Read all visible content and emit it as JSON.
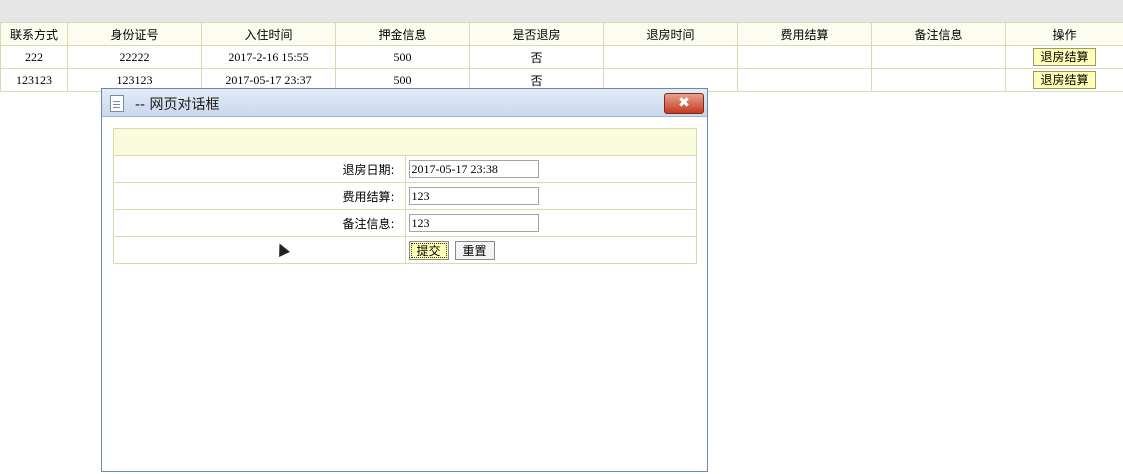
{
  "table": {
    "headers": [
      "联系方式",
      "身份证号",
      "入住时间",
      "押金信息",
      "是否退房",
      "退房时间",
      "费用结算",
      "备注信息",
      "操作"
    ],
    "rows": [
      {
        "contact": "222",
        "id_number": "22222",
        "checkin_time": "2017-2-16 15:55",
        "deposit": "500",
        "checked_out": "否",
        "checkout_time": "",
        "settlement": "",
        "remark": "",
        "action": "退房结算"
      },
      {
        "contact": "123123",
        "id_number": "123123",
        "checkin_time": "2017-05-17 23:37",
        "deposit": "500",
        "checked_out": "否",
        "checkout_time": "",
        "settlement": "",
        "remark": "",
        "action": "退房结算"
      }
    ]
  },
  "dialog": {
    "title": "-- 网页对话框",
    "close_symbol": "✖",
    "fields": {
      "checkout_date": {
        "label": "退房日期:",
        "value": "2017-05-17 23:38"
      },
      "settlement": {
        "label": "费用结算:",
        "value": "123"
      },
      "remark": {
        "label": "备注信息:",
        "value": "123"
      }
    },
    "buttons": {
      "submit": "提交",
      "reset": "重置"
    }
  },
  "colors": {
    "accent_yellow": "#ffffb8",
    "close_red": "#c43c22",
    "border": "#d7dcb0"
  },
  "icons": [
    "document-icon",
    "close-icon"
  ]
}
